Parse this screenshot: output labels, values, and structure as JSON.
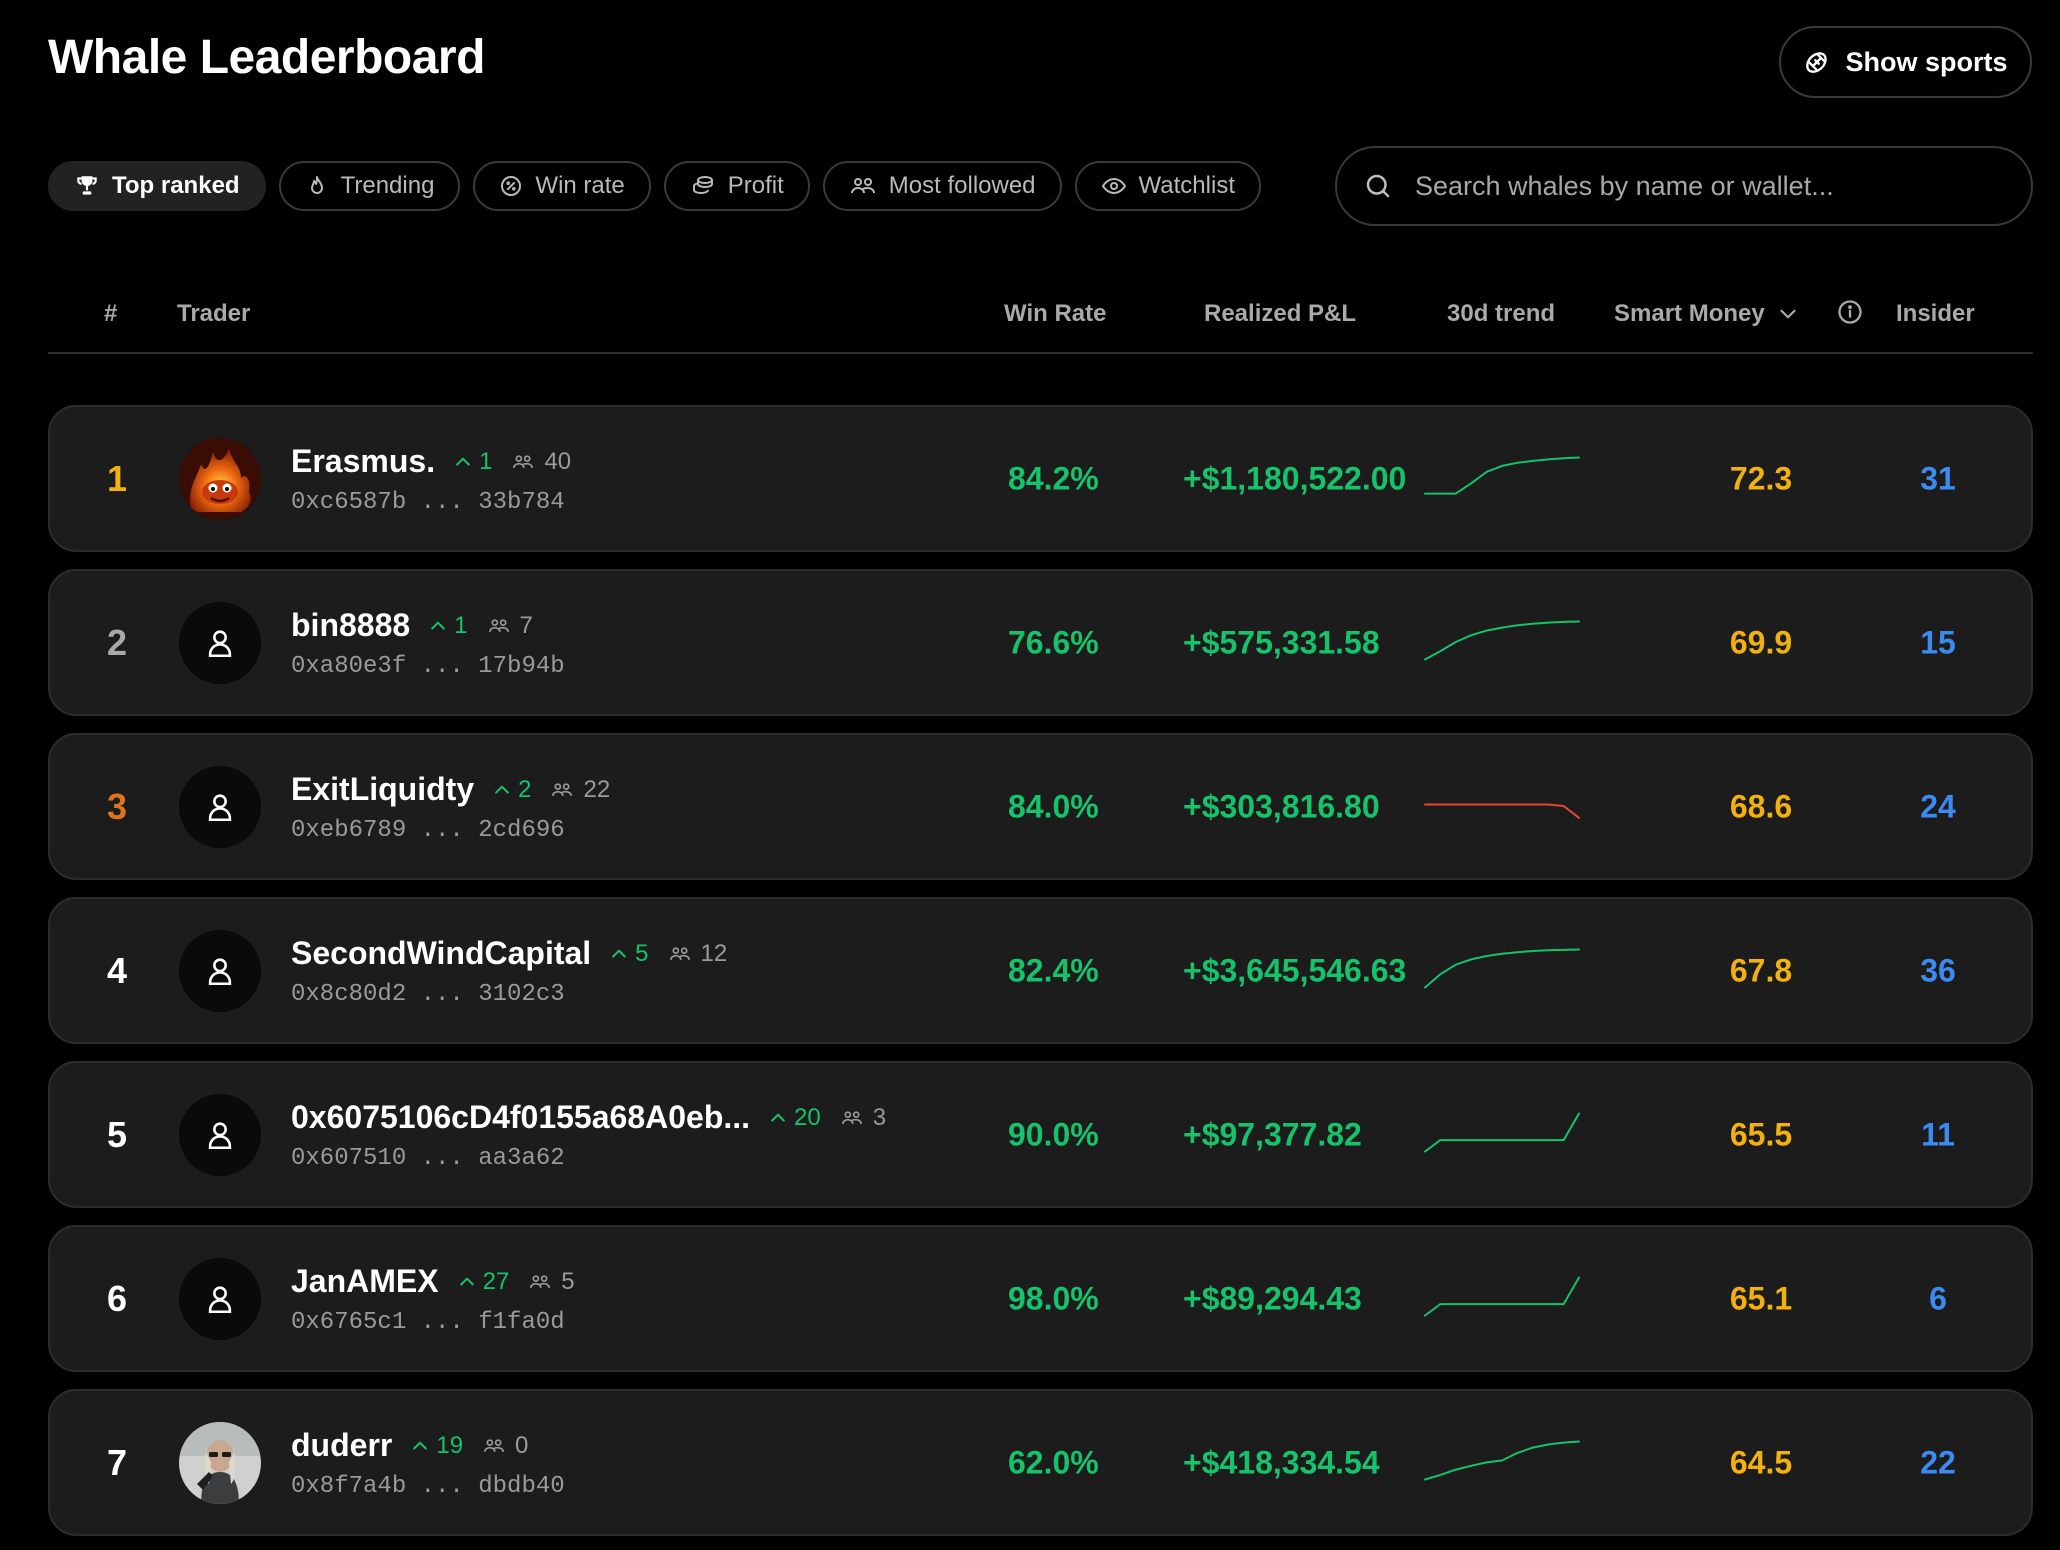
{
  "header": {
    "title": "Whale Leaderboard",
    "show_sports_label": "Show sports"
  },
  "filters": [
    {
      "label": "Top ranked",
      "icon": "trophy-icon",
      "active": true
    },
    {
      "label": "Trending",
      "icon": "flame-icon",
      "active": false
    },
    {
      "label": "Win rate",
      "icon": "percent-icon",
      "active": false
    },
    {
      "label": "Profit",
      "icon": "coins-icon",
      "active": false
    },
    {
      "label": "Most followed",
      "icon": "users-icon",
      "active": false
    },
    {
      "label": "Watchlist",
      "icon": "eye-icon",
      "active": false
    }
  ],
  "search": {
    "placeholder": "Search whales by name or wallet..."
  },
  "columns": {
    "rank": "#",
    "trader": "Trader",
    "win_rate": "Win Rate",
    "realized_pnl": "Realized P&L",
    "trend": "30d trend",
    "smart_money": "Smart Money",
    "insider": "Insider"
  },
  "colors": {
    "positive": "#16c26a",
    "negative": "#e5483b",
    "smart_money": "#f2b10f",
    "insider": "#3c8bf2",
    "rank_gold": "#f2b10f",
    "rank_bronze": "#e0741a",
    "rank_silver": "#a9a9a9"
  },
  "rows": [
    {
      "rank": "1",
      "rank_color": "#f2b10f",
      "avatar": "fire-avatar",
      "name": "Erasmus.",
      "delta": "1",
      "followers": "40",
      "wallet": "0xc6587b ... 33b784",
      "win_rate": "84.2%",
      "pnl": "+$1,180,522.00",
      "trend_dir": "up",
      "trend": [
        0.05,
        0.05,
        0.05,
        0.32,
        0.62,
        0.78,
        0.86,
        0.91,
        0.95,
        0.98,
        1.0
      ],
      "smart_money": "72.3",
      "insider": "31"
    },
    {
      "rank": "2",
      "rank_color": "#a9a9a9",
      "avatar": "user-icon",
      "name": "bin8888",
      "delta": "1",
      "followers": "7",
      "wallet": "0xa80e3f ... 17b94b",
      "win_rate": "76.6%",
      "pnl": "+$575,331.58",
      "trend_dir": "up",
      "trend": [
        0.0,
        0.22,
        0.46,
        0.64,
        0.76,
        0.84,
        0.9,
        0.94,
        0.97,
        0.99,
        1.0
      ],
      "smart_money": "69.9",
      "insider": "15"
    },
    {
      "rank": "3",
      "rank_color": "#e0741a",
      "avatar": "user-icon",
      "name": "ExitLiquidty",
      "delta": "2",
      "followers": "22",
      "wallet": "0xeb6789 ... 2cd696",
      "win_rate": "84.0%",
      "pnl": "+$303,816.80",
      "trend_dir": "down",
      "trend": [
        0.5,
        0.5,
        0.5,
        0.5,
        0.5,
        0.5,
        0.5,
        0.5,
        0.5,
        0.46,
        0.15
      ],
      "smart_money": "68.6",
      "insider": "24"
    },
    {
      "rank": "4",
      "rank_color": "#ffffff",
      "avatar": "user-icon",
      "name": "SecondWindCapital",
      "delta": "5",
      "followers": "12",
      "wallet": "0x8c80d2 ... 3102c3",
      "win_rate": "82.4%",
      "pnl": "+$3,645,546.63",
      "trend_dir": "up",
      "trend": [
        0.0,
        0.35,
        0.6,
        0.74,
        0.83,
        0.89,
        0.93,
        0.96,
        0.98,
        0.99,
        1.0
      ],
      "smart_money": "67.8",
      "insider": "36"
    },
    {
      "rank": "5",
      "rank_color": "#ffffff",
      "avatar": "user-icon",
      "name": "0x6075106cD4f0155a68A0eb...",
      "delta": "20",
      "followers": "3",
      "wallet": "0x607510 ... aa3a62",
      "win_rate": "90.0%",
      "pnl": "+$97,377.82",
      "trend_dir": "up",
      "trend": [
        0.0,
        0.3,
        0.3,
        0.3,
        0.3,
        0.3,
        0.3,
        0.3,
        0.3,
        0.3,
        1.0
      ],
      "smart_money": "65.5",
      "insider": "11"
    },
    {
      "rank": "6",
      "rank_color": "#ffffff",
      "avatar": "user-icon",
      "name": "JanAMEX",
      "delta": "27",
      "followers": "5",
      "wallet": "0x6765c1 ... f1fa0d",
      "win_rate": "98.0%",
      "pnl": "+$89,294.43",
      "trend_dir": "up",
      "trend": [
        0.0,
        0.3,
        0.3,
        0.3,
        0.3,
        0.3,
        0.3,
        0.3,
        0.3,
        0.3,
        1.0
      ],
      "smart_money": "65.1",
      "insider": "6"
    },
    {
      "rank": "7",
      "rank_color": "#ffffff",
      "avatar": "photo-avatar",
      "name": "duderr",
      "delta": "19",
      "followers": "0",
      "wallet": "0x8f7a4b ... dbdb40",
      "win_rate": "62.0%",
      "pnl": "+$418,334.54",
      "trend_dir": "up",
      "trend": [
        0.0,
        0.12,
        0.26,
        0.36,
        0.45,
        0.5,
        0.7,
        0.84,
        0.92,
        0.97,
        1.0
      ],
      "smart_money": "64.5",
      "insider": "22"
    }
  ]
}
